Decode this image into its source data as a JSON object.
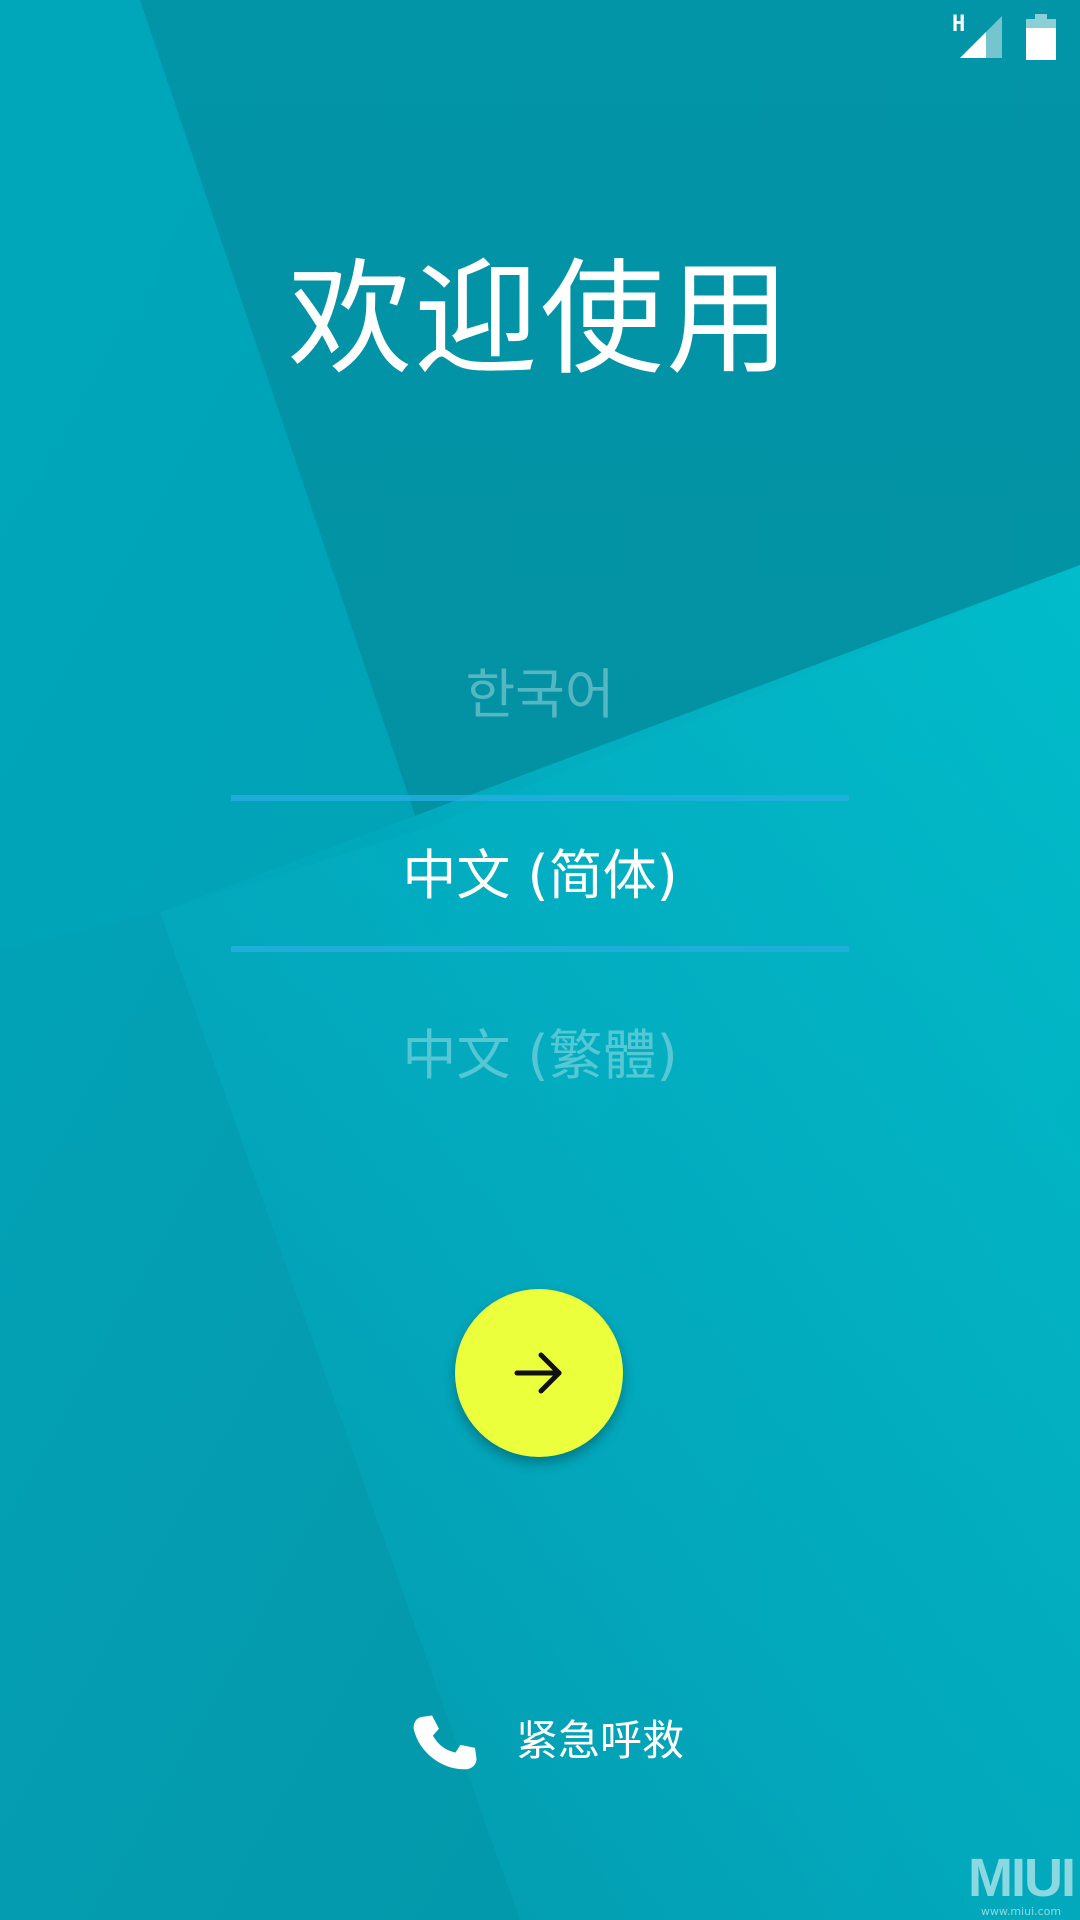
{
  "status_bar": {
    "network_type": "H",
    "signal_icon": "cellular-signal-icon",
    "battery_icon": "battery-icon"
  },
  "welcome": {
    "title": "欢迎使用"
  },
  "language_picker": {
    "options": [
      {
        "label": "한국어",
        "selected": false
      },
      {
        "label": "中文 (简体)",
        "selected": true
      },
      {
        "label": "中文 (繁體)",
        "selected": false
      }
    ]
  },
  "next_button": {
    "icon": "arrow-right-icon",
    "color": "#ecff3c"
  },
  "emergency": {
    "icon": "phone-icon",
    "label": "紧急呼救"
  },
  "watermark": {
    "logo": "MIUI",
    "url": "www.miui.com"
  },
  "colors": {
    "background": "#0497a8",
    "accent_divider": "#27aee0",
    "button": "#ecff3c"
  }
}
